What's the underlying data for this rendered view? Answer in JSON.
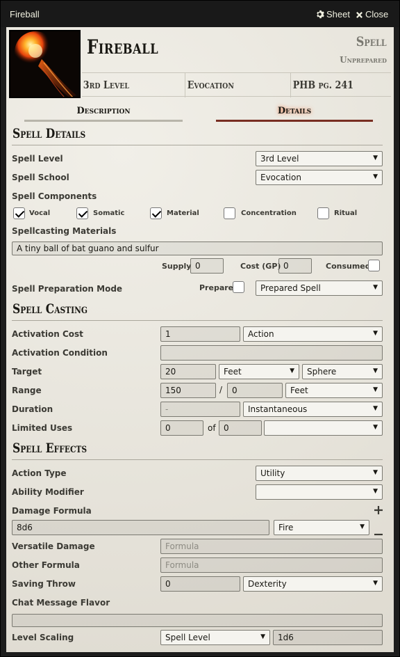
{
  "window": {
    "title": "Fireball",
    "sheet_label": "Sheet",
    "close_label": "Close"
  },
  "header": {
    "name": "Fireball",
    "type": "Spell",
    "status": "Unprepared",
    "level": "3rd Level",
    "school": "Evocation",
    "source": "PHB pg. 241"
  },
  "tabs": {
    "description": "Description",
    "details": "Details",
    "active": "details"
  },
  "spell_details": {
    "heading": "Spell Details",
    "spell_level_label": "Spell Level",
    "spell_level_value": "3rd Level",
    "spell_school_label": "Spell School",
    "spell_school_value": "Evocation",
    "components_label": "Spell Components",
    "components": [
      {
        "label": "Vocal",
        "checked": true
      },
      {
        "label": "Somatic",
        "checked": true
      },
      {
        "label": "Material",
        "checked": true
      },
      {
        "label": "Concentration",
        "checked": false
      },
      {
        "label": "Ritual",
        "checked": false
      }
    ],
    "materials_label": "Spellcasting Materials",
    "materials_value": "A tiny ball of bat guano and sulfur",
    "supply_label": "Supply",
    "supply_value": "0",
    "cost_label": "Cost (GP)",
    "cost_value": "0",
    "consumed_label": "Consumed",
    "preparation_label": "Spell Preparation Mode",
    "prepared_label": "Prepared",
    "preparation_value": "Prepared Spell"
  },
  "spell_casting": {
    "heading": "Spell Casting",
    "activation_cost_label": "Activation Cost",
    "activation_cost_value": "1",
    "activation_type": "Action",
    "activation_condition_label": "Activation Condition",
    "activation_condition_value": "",
    "target_label": "Target",
    "target_value": "20",
    "target_units": "Feet",
    "target_type": "Sphere",
    "range_label": "Range",
    "range_value": "150",
    "range_separator": "/",
    "range_long": "0",
    "range_units": "Feet",
    "duration_label": "Duration",
    "duration_value": "-",
    "duration_units": "Instantaneous",
    "limited_uses_label": "Limited Uses",
    "uses_value": "0",
    "uses_of": "of",
    "uses_max": "0",
    "uses_per": ""
  },
  "spell_effects": {
    "heading": "Spell Effects",
    "action_type_label": "Action Type",
    "action_type_value": "Utility",
    "ability_modifier_label": "Ability Modifier",
    "ability_modifier_value": "",
    "damage_formula_label": "Damage Formula",
    "damage_formula_value": "8d6",
    "damage_type": "Fire",
    "versatile_label": "Versatile Damage",
    "versatile_placeholder": "Formula",
    "other_formula_label": "Other Formula",
    "other_formula_placeholder": "Formula",
    "saving_throw_label": "Saving Throw",
    "saving_throw_dc": "0",
    "saving_throw_ability": "Dexterity",
    "chat_flavor_label": "Chat Message Flavor",
    "chat_flavor_value": "",
    "level_scaling_label": "Level Scaling",
    "level_scaling_mode": "Spell Level",
    "level_scaling_formula": "1d6"
  },
  "icons": [
    "gear-icon",
    "close-icon",
    "plus-icon",
    "minus-icon",
    "dropdown-arrow-icon"
  ]
}
